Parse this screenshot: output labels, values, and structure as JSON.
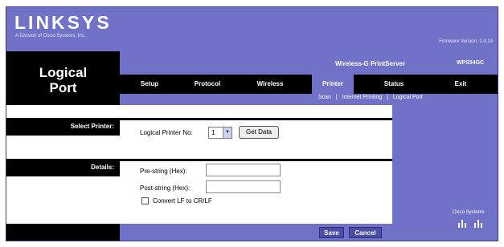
{
  "header": {
    "brand": "LINKSYS",
    "brand_sub": "A Division of Cisco Systems, Inc.",
    "firmware": "Firmware Version: 1.0.14",
    "product_name": "Wireless-G PrintServer",
    "model": "WPS54GC"
  },
  "page_title": "Logical Port",
  "tabs": [
    {
      "label": "Setup",
      "active": false
    },
    {
      "label": "Protocol",
      "active": false
    },
    {
      "label": "Wireless",
      "active": false
    },
    {
      "label": "Printer",
      "active": true
    },
    {
      "label": "Status",
      "active": false
    },
    {
      "label": "Exit",
      "active": false
    }
  ],
  "subtabs": [
    "Scan",
    "|",
    "Internet Printing",
    "|",
    "Logical Port"
  ],
  "sections": {
    "select_printer": "Select Printer:",
    "details": "Details:"
  },
  "form": {
    "logical_printer_label": "Logical Printer No:",
    "logical_printer_value": "1",
    "get_data_button": "Get Data",
    "pre_string_label": "Pre-string (Hex):",
    "pre_string_value": "",
    "post_string_label": "Post-string (Hex):",
    "post_string_value": "",
    "convert_label": "Convert LF to CR/LF",
    "convert_checked": false
  },
  "footer": {
    "save": "Save",
    "cancel": "Cancel",
    "cisco": "Cisco Systems"
  },
  "colors": {
    "accent": "#6f72c6",
    "dark": "#000000",
    "button": "#4a4ea8"
  }
}
